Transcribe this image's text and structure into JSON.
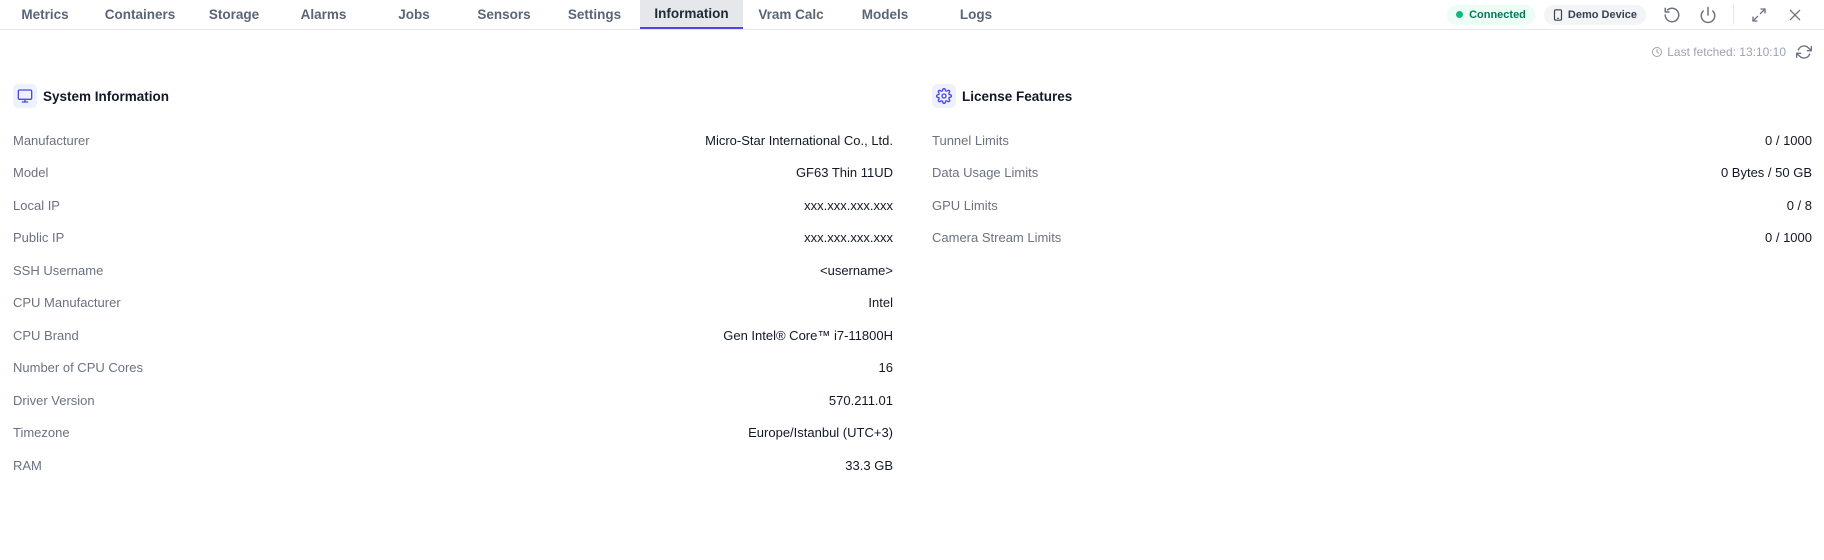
{
  "tabs": [
    {
      "label": "Metrics",
      "name": "tab-metrics"
    },
    {
      "label": "Containers",
      "name": "tab-containers"
    },
    {
      "label": "Storage",
      "name": "tab-storage"
    },
    {
      "label": "Alarms",
      "name": "tab-alarms"
    },
    {
      "label": "Jobs",
      "name": "tab-jobs"
    },
    {
      "label": "Sensors",
      "name": "tab-sensors"
    },
    {
      "label": "Settings",
      "name": "tab-settings"
    },
    {
      "label": "Information",
      "name": "tab-information"
    },
    {
      "label": "Vram Calc",
      "name": "tab-vram-calc"
    },
    {
      "label": "Models",
      "name": "tab-models"
    },
    {
      "label": "Logs",
      "name": "tab-logs"
    }
  ],
  "active_tab": "Information",
  "header": {
    "status": "Connected",
    "device": "Demo Device"
  },
  "last_fetched": "Last fetched: 13:10:10",
  "system_info": {
    "title": "System Information",
    "rows": [
      {
        "label": "Manufacturer",
        "value": "Micro-Star International Co., Ltd."
      },
      {
        "label": "Model",
        "value": "GF63 Thin 11UD"
      },
      {
        "label": "Local IP",
        "value": "xxx.xxx.xxx.xxx"
      },
      {
        "label": "Public IP",
        "value": "xxx.xxx.xxx.xxx"
      },
      {
        "label": "SSH Username",
        "value": "<username>"
      },
      {
        "label": "CPU Manufacturer",
        "value": "Intel"
      },
      {
        "label": "CPU Brand",
        "value": "Gen Intel® Core™ i7-11800H"
      },
      {
        "label": "Number of CPU Cores",
        "value": "16"
      },
      {
        "label": "Driver Version",
        "value": "570.211.01"
      },
      {
        "label": "Timezone",
        "value": "Europe/Istanbul (UTC+3)"
      },
      {
        "label": "RAM",
        "value": "33.3 GB"
      }
    ]
  },
  "license": {
    "title": "License Features",
    "rows": [
      {
        "label": "Tunnel Limits",
        "value": "0 / 1000"
      },
      {
        "label": "Data Usage Limits",
        "value": "0 Bytes / 50 GB"
      },
      {
        "label": "GPU Limits",
        "value": "0 / 8"
      },
      {
        "label": "Camera Stream Limits",
        "value": "0 / 1000"
      }
    ]
  },
  "colors": {
    "accent": "#4f46e5",
    "status_green": "#10b981",
    "label_gray": "#6b7280"
  },
  "icons": [
    "monitor-icon",
    "gear-icon",
    "clock-icon",
    "refresh-icon",
    "device-icon",
    "restart-icon",
    "power-icon",
    "expand-icon",
    "close-icon"
  ]
}
